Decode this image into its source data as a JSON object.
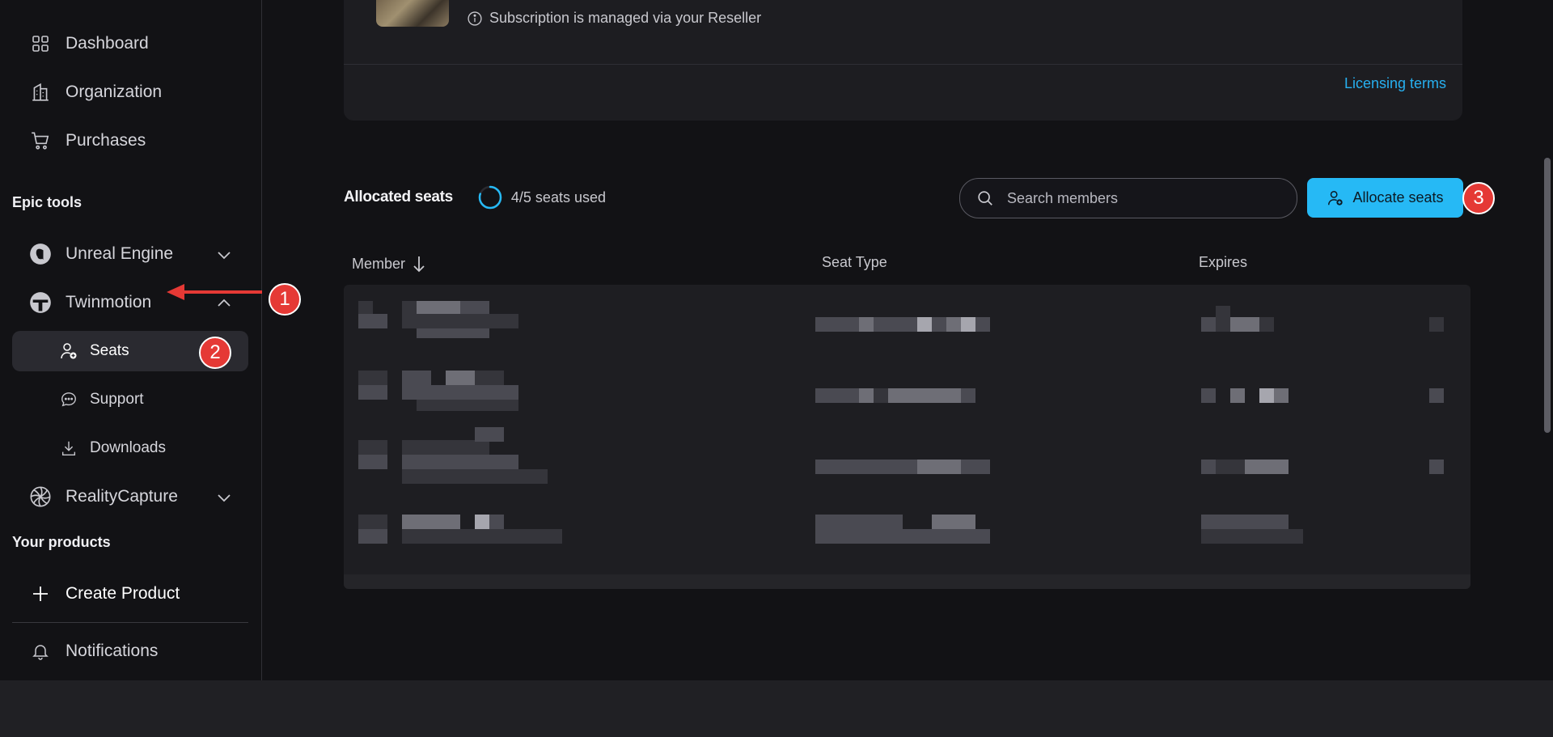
{
  "sidebar": {
    "items": [
      {
        "label": "Dashboard",
        "icon": "dashboard-grid-icon"
      },
      {
        "label": "Organization",
        "icon": "building-icon"
      },
      {
        "label": "Purchases",
        "icon": "cart-icon"
      }
    ],
    "section_epic_tools": "Epic tools",
    "tools": [
      {
        "label": "Unreal Engine",
        "icon": "unreal-logo-icon",
        "expanded": false
      },
      {
        "label": "Twinmotion",
        "icon": "twinmotion-logo-icon",
        "expanded": true
      },
      {
        "label": "RealityCapture",
        "icon": "realitycapture-logo-icon",
        "expanded": false
      }
    ],
    "twinmotion_sub": [
      {
        "label": "Seats",
        "icon": "user-plus-icon",
        "active": true
      },
      {
        "label": "Support",
        "icon": "chat-bubble-icon",
        "active": false
      },
      {
        "label": "Downloads",
        "icon": "download-icon",
        "active": false
      }
    ],
    "section_products": "Your products",
    "create_product": "Create Product",
    "notifications": "Notifications"
  },
  "subscription": {
    "notice": "Subscription is managed via your Reseller",
    "licensing_link": "Licensing terms"
  },
  "seats": {
    "title": "Allocated seats",
    "usage_text": "4/5 seats used",
    "usage_fraction": 0.8,
    "search_placeholder": "Search members",
    "allocate_label": "Allocate seats"
  },
  "table": {
    "columns": [
      "Member",
      "Seat Type",
      "Expires"
    ],
    "rows_redacted": 4
  },
  "annotations": [
    "1",
    "2",
    "3"
  ],
  "colors": {
    "accent": "#26b9f5",
    "link": "#27b0f0",
    "annotation_red": "#e53935",
    "background": "#121215"
  }
}
